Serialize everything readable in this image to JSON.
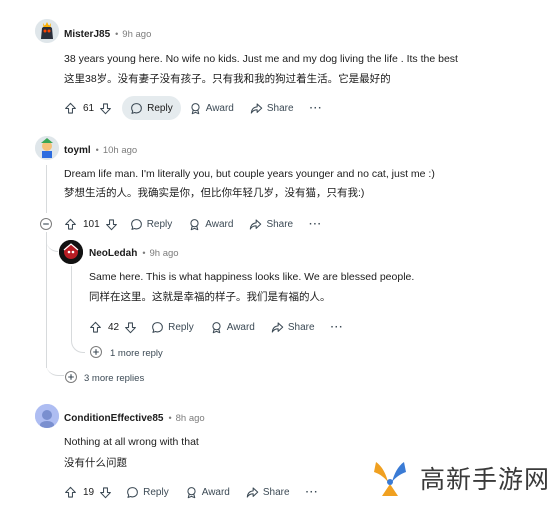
{
  "comments": [
    {
      "author": "MisterJ85",
      "time": "9h ago",
      "line1": "38 years young here. No wife no kids. Just me and my dog living the life . Its the best",
      "line2": "这里38岁。没有妻子没有孩子。只有我和我的狗过着生活。它是最好的",
      "votes": "61",
      "reply": "Reply",
      "award": "Award",
      "share": "Share",
      "more": "···"
    },
    {
      "author": "toyml",
      "time": "10h ago",
      "line1": "Dream life man. I'm literally you, but couple years younger and no cat, just me :)",
      "line2": "梦想生活的人。我确实是你，但比你年轻几岁，没有猫，只有我:)",
      "votes": "101",
      "reply": "Reply",
      "award": "Award",
      "share": "Share",
      "more": "···",
      "more_replies": "3 more replies"
    },
    {
      "author": "NeoLedah",
      "time": "9h ago",
      "line1": "Same here. This is what happiness looks like. We are blessed people.",
      "line2": "同样在这里。这就是幸福的样子。我们是有福的人。",
      "votes": "42",
      "reply": "Reply",
      "award": "Award",
      "share": "Share",
      "more": "···",
      "more_replies": "1 more reply"
    },
    {
      "author": "ConditionEffective85",
      "time": "8h ago",
      "line1": "Nothing at all wrong with that",
      "line2": "没有什么问题",
      "votes": "19",
      "reply": "Reply",
      "award": "Award",
      "share": "Share",
      "more": "···"
    }
  ],
  "watermark": {
    "text": "高新手游网"
  },
  "colors": {
    "accent_active": "#e5ebee",
    "thread_line": "#d7dadc",
    "meta_gray": "#7c7c7c"
  }
}
